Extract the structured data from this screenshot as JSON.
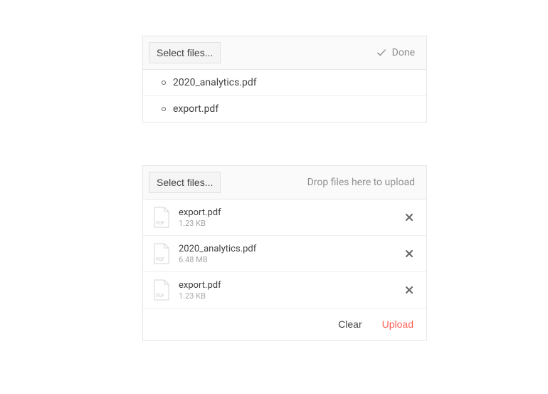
{
  "uploaderA": {
    "select_label": "Select files...",
    "done_label": "Done",
    "files": [
      {
        "name": "2020_analytics.pdf"
      },
      {
        "name": "export.pdf"
      }
    ]
  },
  "uploaderB": {
    "select_label": "Select files...",
    "dropzone_hint": "Drop files here to upload",
    "ext_label": "PDF",
    "clear_label": "Clear",
    "upload_label": "Upload",
    "files": [
      {
        "name": "export.pdf",
        "size": "1.23 KB"
      },
      {
        "name": "2020_analytics.pdf",
        "size": "6.48 MB"
      },
      {
        "name": "export.pdf",
        "size": "1.23 KB"
      }
    ]
  }
}
